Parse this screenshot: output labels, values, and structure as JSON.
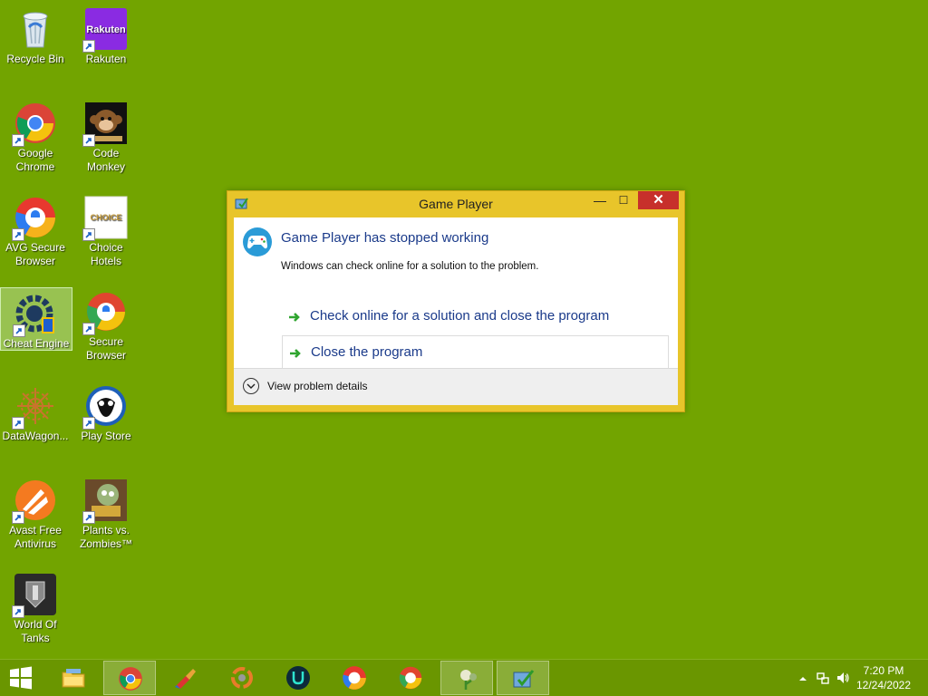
{
  "desktop": {
    "icons": [
      {
        "label": "Recycle Bin",
        "icon": "recycle-bin-icon"
      },
      {
        "label": "Rakuten",
        "icon": "rakuten-icon",
        "logo_text": "Rakuten"
      },
      {
        "label": "Google Chrome",
        "icon": "chrome-icon"
      },
      {
        "label": "Code Monkey",
        "icon": "code-monkey-icon"
      },
      {
        "label": "AVG Secure Browser",
        "icon": "avg-browser-icon"
      },
      {
        "label": "Choice Hotels",
        "icon": "choice-hotels-icon",
        "logo_text": "CHOICE"
      },
      {
        "label": "Cheat Engine",
        "icon": "cheat-engine-icon",
        "selected": true
      },
      {
        "label": "Secure Browser",
        "icon": "secure-browser-icon"
      },
      {
        "label": "DataWagon...",
        "icon": "datawagon-icon"
      },
      {
        "label": "Play Store",
        "icon": "play-store-icon"
      },
      {
        "label": "Avast Free Antivirus",
        "icon": "avast-icon"
      },
      {
        "label": "Plants vs. Zombies™",
        "icon": "plants-vs-zombies-icon"
      },
      {
        "label": "World Of Tanks",
        "icon": "world-of-tanks-icon"
      }
    ]
  },
  "dialog": {
    "title": "Game Player",
    "main_instruction": "Game Player has stopped working",
    "content": "Windows can check online for a solution to the problem.",
    "commands": [
      {
        "label": "Check online for a solution and close the program"
      },
      {
        "label": "Close the program"
      }
    ],
    "footer_label": "View problem details",
    "controls": {
      "minimize": "—",
      "maximize": "☐",
      "close": "✕"
    }
  },
  "taskbar": {
    "apps": [
      {
        "name": "file-explorer-icon"
      },
      {
        "name": "chrome-icon",
        "active": true
      },
      {
        "name": "ccleaner-icon"
      },
      {
        "name": "datawagon-icon"
      },
      {
        "name": "u-app-icon"
      },
      {
        "name": "avg-browser-icon"
      },
      {
        "name": "secure-browser-icon"
      },
      {
        "name": "plants-vs-zombies-icon",
        "active": true
      },
      {
        "name": "game-player-icon",
        "active": true
      }
    ],
    "clock": {
      "time": "7:20 PM",
      "date": "12/24/2022"
    },
    "tray": [
      "show-hidden-icons-icon",
      "network-icon",
      "volume-icon"
    ]
  },
  "colors": {
    "desktop": "#72a400",
    "dialog_frame": "#e8c52a",
    "close_button": "#c7302b",
    "link_text": "#1a3a8a"
  }
}
